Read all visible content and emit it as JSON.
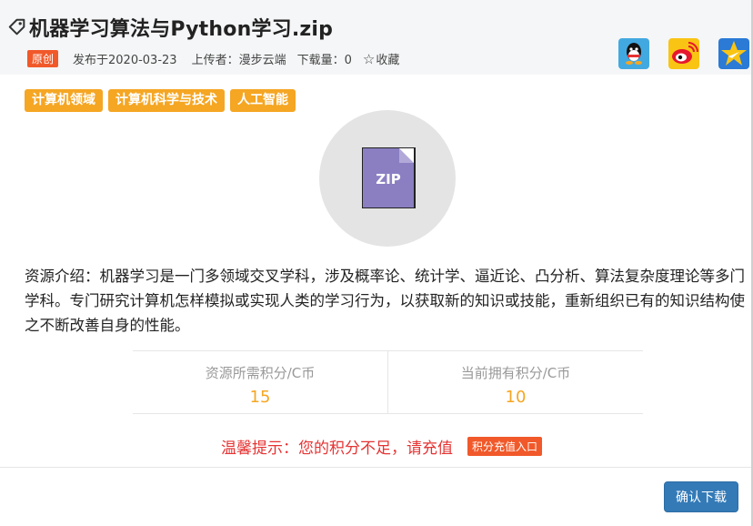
{
  "header": {
    "title": "机器学习算法与Python学习.zip",
    "original_badge": "原创",
    "published": "发布于2020-03-23",
    "uploader": "上传者：漫步云端",
    "downloads": "下载量：0",
    "favorite_label": "收藏",
    "share_icons": [
      "qq-icon",
      "weibo-icon",
      "qzone-icon"
    ]
  },
  "tags": [
    "计算机领域",
    "计算机科学与技术",
    "人工智能"
  ],
  "file": {
    "type_label": "ZIP"
  },
  "description": "资源介绍：机器学习是一门多领域交叉学科，涉及概率论、统计学、逼近论、凸分析、算法复杂度理论等多门学科。专门研究计算机怎样模拟或实现人类的学习行为，以获取新的知识或技能，重新组织已有的知识结构使之不断改善自身的性能。",
  "points": {
    "required_label": "资源所需积分/C币",
    "required_value": "15",
    "owned_label": "当前拥有积分/C币",
    "owned_value": "10"
  },
  "tip": {
    "text": "温馨提示：您的积分不足，请充值",
    "recharge_label": "积分充值入口"
  },
  "confirm_label": "确认下载",
  "colors": {
    "accent_orange": "#f5a623",
    "badge_red": "#f1592a",
    "warning_red": "#e53333",
    "primary_blue": "#337ab7"
  }
}
